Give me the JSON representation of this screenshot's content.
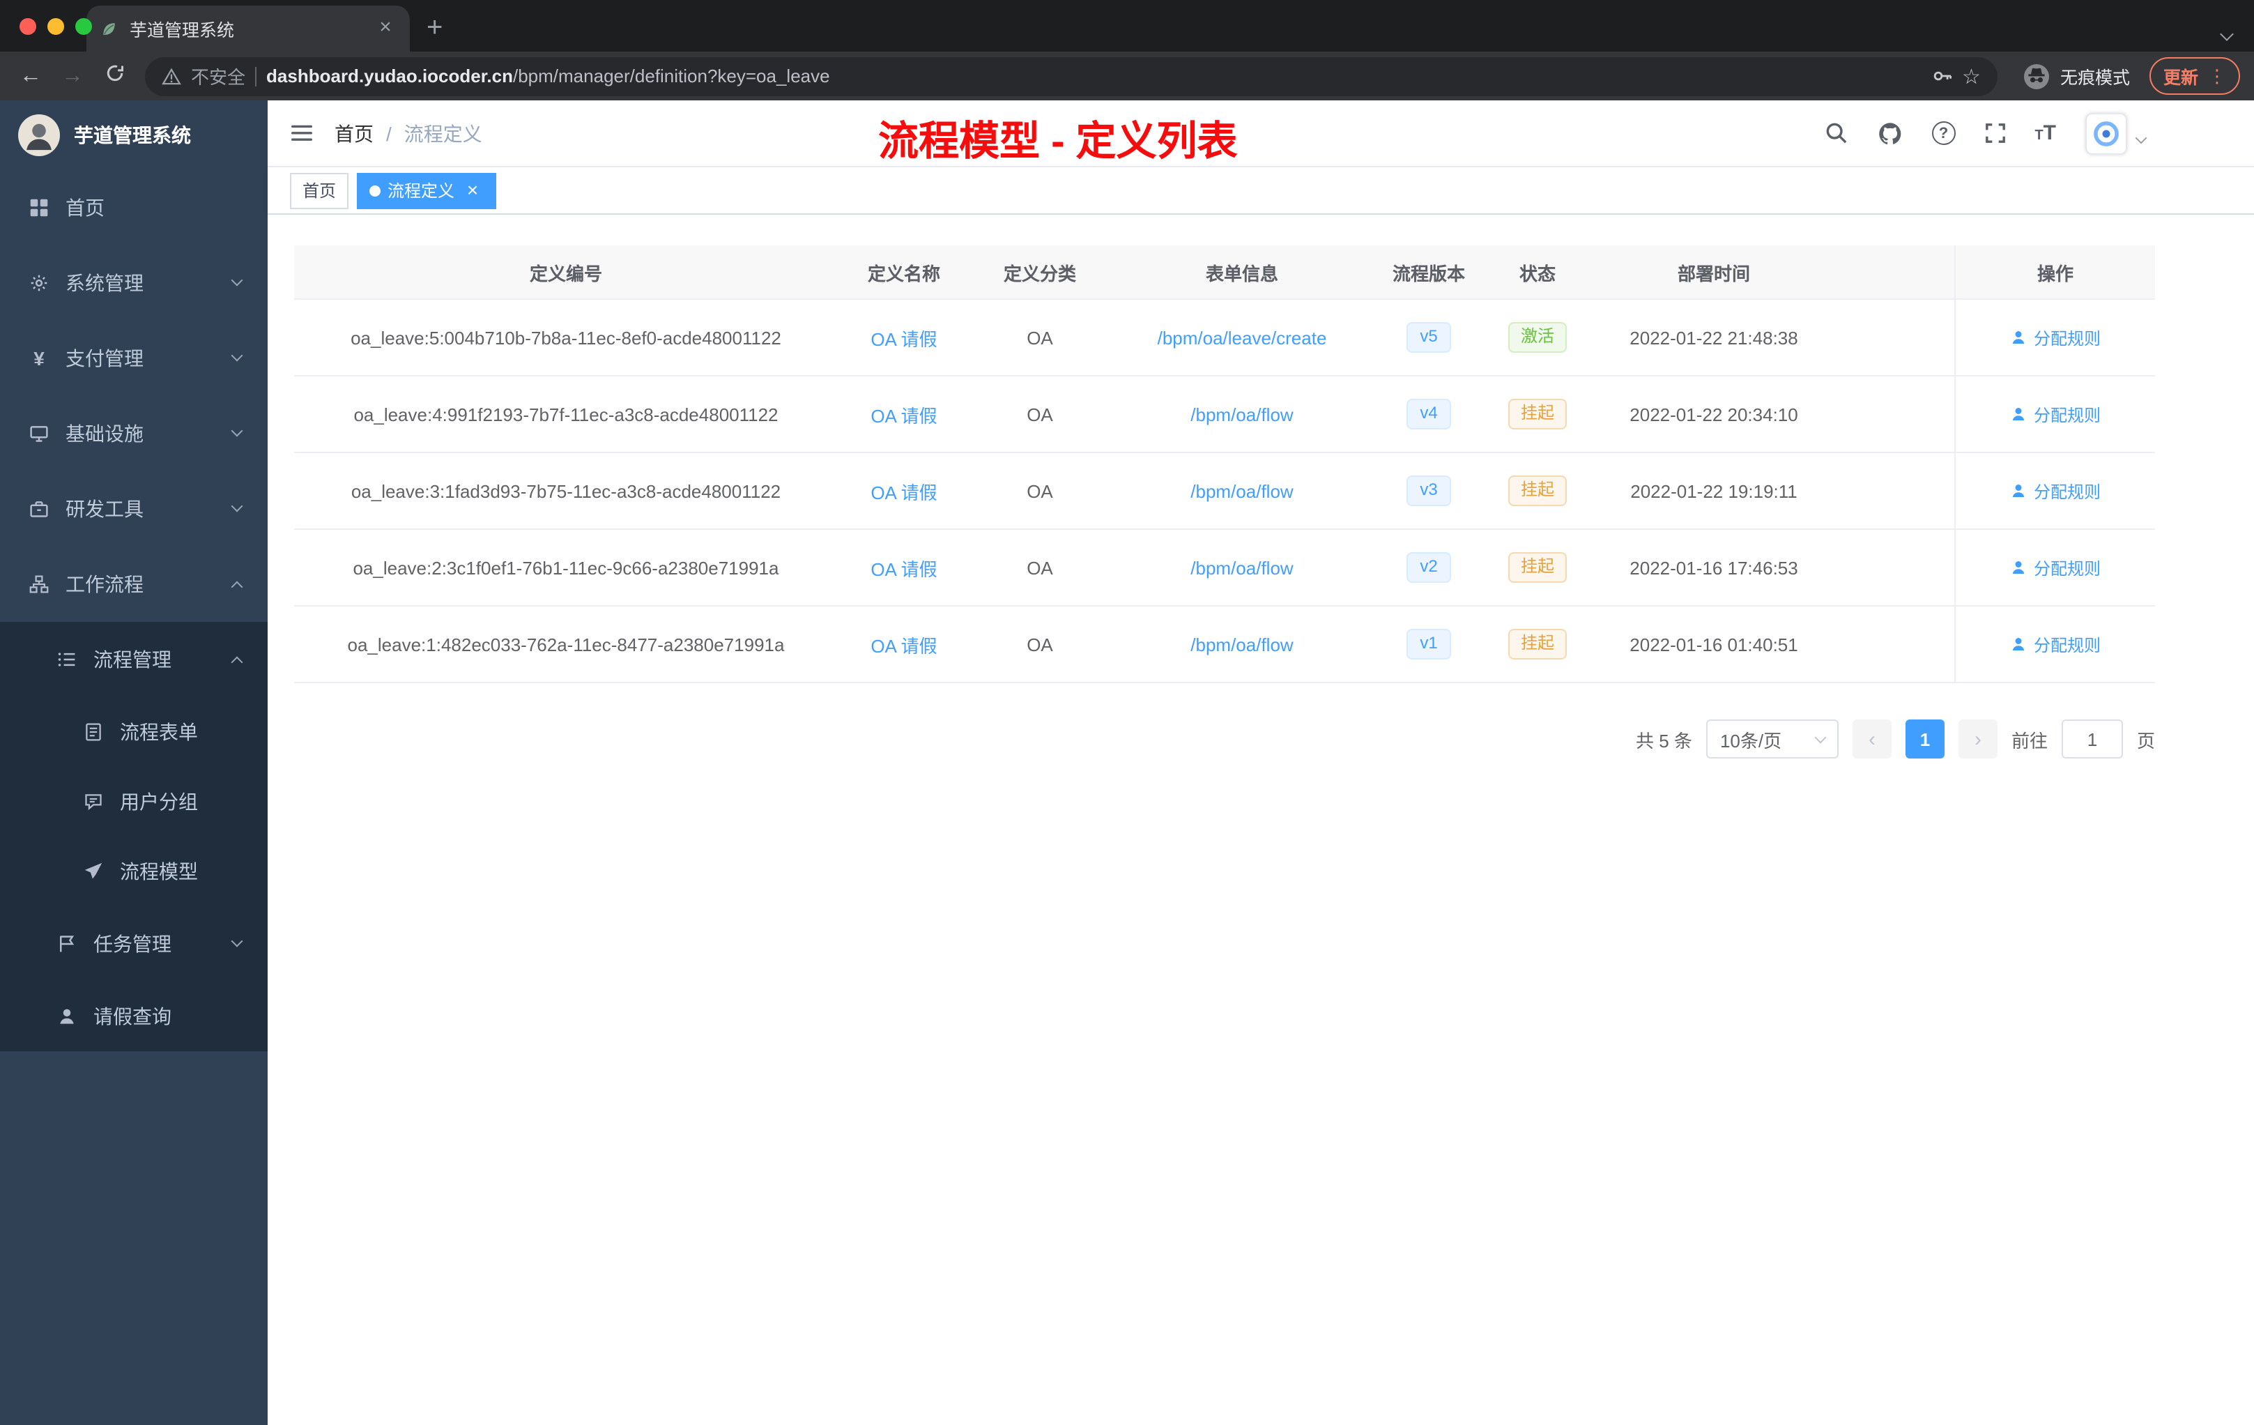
{
  "colors": {
    "primary": "#409eff",
    "success": "#67c23a",
    "warning": "#e6a23c",
    "annotation": "#f50d0d",
    "sidebar_bg": "#304156",
    "submenu_bg": "#1f2d3d"
  },
  "icons": {
    "close": "×",
    "plus": "+",
    "back": "←",
    "forward": "→",
    "star": "☆",
    "kebab": "⋮",
    "question": "?",
    "yen": "¥",
    "prev": "‹",
    "next": "›",
    "font_size_large": "T",
    "font_size_small": "T"
  },
  "browser": {
    "tab_title": "芋道管理系统",
    "security_label": "不安全",
    "url_domain": "dashboard.yudao.iocoder.cn",
    "url_path": "/bpm/manager/definition?key=oa_leave",
    "incognito_label": "无痕模式",
    "update_label": "更新"
  },
  "sidebar": {
    "logo_title": "芋道管理系统",
    "menu": [
      {
        "label": "首页"
      },
      {
        "label": "系统管理"
      },
      {
        "label": "支付管理"
      },
      {
        "label": "基础设施"
      },
      {
        "label": "研发工具"
      },
      {
        "label": "工作流程"
      },
      {
        "label": "流程管理"
      },
      {
        "label": "流程表单"
      },
      {
        "label": "用户分组"
      },
      {
        "label": "流程模型"
      },
      {
        "label": "任务管理"
      },
      {
        "label": "请假查询"
      }
    ]
  },
  "navbar": {
    "breadcrumb_home": "首页",
    "breadcrumb_sep": "/",
    "breadcrumb_current": "流程定义",
    "annotation": "流程模型 - 定义列表"
  },
  "tags": {
    "home": "首页",
    "active": "流程定义"
  },
  "table": {
    "columns": {
      "id": "定义编号",
      "name": "定义名称",
      "category": "定义分类",
      "form": "表单信息",
      "version": "流程版本",
      "status": "状态",
      "deploy_time": "部署时间",
      "actions": "操作"
    },
    "action_label": "分配规则",
    "rows": [
      {
        "id": "oa_leave:5:004b710b-7b8a-11ec-8ef0-acde48001122",
        "name": "OA 请假",
        "category": "OA",
        "form": "/bpm/oa/leave/create",
        "version": "v5",
        "status": "激活",
        "deploy_time": "2022-01-22 21:48:38"
      },
      {
        "id": "oa_leave:4:991f2193-7b7f-11ec-a3c8-acde48001122",
        "name": "OA 请假",
        "category": "OA",
        "form": "/bpm/oa/flow",
        "version": "v4",
        "status": "挂起",
        "deploy_time": "2022-01-22 20:34:10"
      },
      {
        "id": "oa_leave:3:1fad3d93-7b75-11ec-a3c8-acde48001122",
        "name": "OA 请假",
        "category": "OA",
        "form": "/bpm/oa/flow",
        "version": "v3",
        "status": "挂起",
        "deploy_time": "2022-01-22 19:19:11"
      },
      {
        "id": "oa_leave:2:3c1f0ef1-76b1-11ec-9c66-a2380e71991a",
        "name": "OA 请假",
        "category": "OA",
        "form": "/bpm/oa/flow",
        "version": "v2",
        "status": "挂起",
        "deploy_time": "2022-01-16 17:46:53"
      },
      {
        "id": "oa_leave:1:482ec033-762a-11ec-8477-a2380e71991a",
        "name": "OA 请假",
        "category": "OA",
        "form": "/bpm/oa/flow",
        "version": "v1",
        "status": "挂起",
        "deploy_time": "2022-01-16 01:40:51"
      }
    ]
  },
  "pagination": {
    "total": "共 5 条",
    "page_size": "10条/页",
    "current_page": "1",
    "goto_label": "前往",
    "goto_value": "1",
    "page_unit": "页"
  }
}
